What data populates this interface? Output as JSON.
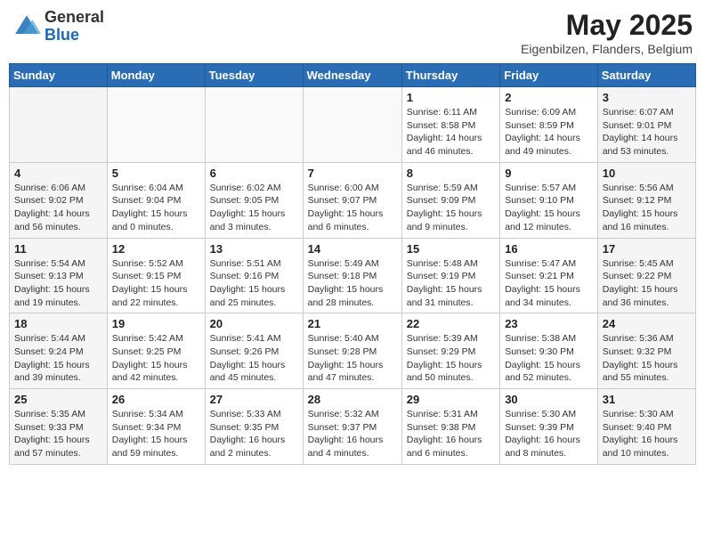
{
  "header": {
    "logo_general": "General",
    "logo_blue": "Blue",
    "month_title": "May 2025",
    "subtitle": "Eigenbilzen, Flanders, Belgium"
  },
  "weekdays": [
    "Sunday",
    "Monday",
    "Tuesday",
    "Wednesday",
    "Thursday",
    "Friday",
    "Saturday"
  ],
  "weeks": [
    [
      {
        "day": "",
        "info": ""
      },
      {
        "day": "",
        "info": ""
      },
      {
        "day": "",
        "info": ""
      },
      {
        "day": "",
        "info": ""
      },
      {
        "day": "1",
        "info": "Sunrise: 6:11 AM\nSunset: 8:58 PM\nDaylight: 14 hours\nand 46 minutes."
      },
      {
        "day": "2",
        "info": "Sunrise: 6:09 AM\nSunset: 8:59 PM\nDaylight: 14 hours\nand 49 minutes."
      },
      {
        "day": "3",
        "info": "Sunrise: 6:07 AM\nSunset: 9:01 PM\nDaylight: 14 hours\nand 53 minutes."
      }
    ],
    [
      {
        "day": "4",
        "info": "Sunrise: 6:06 AM\nSunset: 9:02 PM\nDaylight: 14 hours\nand 56 minutes."
      },
      {
        "day": "5",
        "info": "Sunrise: 6:04 AM\nSunset: 9:04 PM\nDaylight: 15 hours\nand 0 minutes."
      },
      {
        "day": "6",
        "info": "Sunrise: 6:02 AM\nSunset: 9:05 PM\nDaylight: 15 hours\nand 3 minutes."
      },
      {
        "day": "7",
        "info": "Sunrise: 6:00 AM\nSunset: 9:07 PM\nDaylight: 15 hours\nand 6 minutes."
      },
      {
        "day": "8",
        "info": "Sunrise: 5:59 AM\nSunset: 9:09 PM\nDaylight: 15 hours\nand 9 minutes."
      },
      {
        "day": "9",
        "info": "Sunrise: 5:57 AM\nSunset: 9:10 PM\nDaylight: 15 hours\nand 12 minutes."
      },
      {
        "day": "10",
        "info": "Sunrise: 5:56 AM\nSunset: 9:12 PM\nDaylight: 15 hours\nand 16 minutes."
      }
    ],
    [
      {
        "day": "11",
        "info": "Sunrise: 5:54 AM\nSunset: 9:13 PM\nDaylight: 15 hours\nand 19 minutes."
      },
      {
        "day": "12",
        "info": "Sunrise: 5:52 AM\nSunset: 9:15 PM\nDaylight: 15 hours\nand 22 minutes."
      },
      {
        "day": "13",
        "info": "Sunrise: 5:51 AM\nSunset: 9:16 PM\nDaylight: 15 hours\nand 25 minutes."
      },
      {
        "day": "14",
        "info": "Sunrise: 5:49 AM\nSunset: 9:18 PM\nDaylight: 15 hours\nand 28 minutes."
      },
      {
        "day": "15",
        "info": "Sunrise: 5:48 AM\nSunset: 9:19 PM\nDaylight: 15 hours\nand 31 minutes."
      },
      {
        "day": "16",
        "info": "Sunrise: 5:47 AM\nSunset: 9:21 PM\nDaylight: 15 hours\nand 34 minutes."
      },
      {
        "day": "17",
        "info": "Sunrise: 5:45 AM\nSunset: 9:22 PM\nDaylight: 15 hours\nand 36 minutes."
      }
    ],
    [
      {
        "day": "18",
        "info": "Sunrise: 5:44 AM\nSunset: 9:24 PM\nDaylight: 15 hours\nand 39 minutes."
      },
      {
        "day": "19",
        "info": "Sunrise: 5:42 AM\nSunset: 9:25 PM\nDaylight: 15 hours\nand 42 minutes."
      },
      {
        "day": "20",
        "info": "Sunrise: 5:41 AM\nSunset: 9:26 PM\nDaylight: 15 hours\nand 45 minutes."
      },
      {
        "day": "21",
        "info": "Sunrise: 5:40 AM\nSunset: 9:28 PM\nDaylight: 15 hours\nand 47 minutes."
      },
      {
        "day": "22",
        "info": "Sunrise: 5:39 AM\nSunset: 9:29 PM\nDaylight: 15 hours\nand 50 minutes."
      },
      {
        "day": "23",
        "info": "Sunrise: 5:38 AM\nSunset: 9:30 PM\nDaylight: 15 hours\nand 52 minutes."
      },
      {
        "day": "24",
        "info": "Sunrise: 5:36 AM\nSunset: 9:32 PM\nDaylight: 15 hours\nand 55 minutes."
      }
    ],
    [
      {
        "day": "25",
        "info": "Sunrise: 5:35 AM\nSunset: 9:33 PM\nDaylight: 15 hours\nand 57 minutes."
      },
      {
        "day": "26",
        "info": "Sunrise: 5:34 AM\nSunset: 9:34 PM\nDaylight: 15 hours\nand 59 minutes."
      },
      {
        "day": "27",
        "info": "Sunrise: 5:33 AM\nSunset: 9:35 PM\nDaylight: 16 hours\nand 2 minutes."
      },
      {
        "day": "28",
        "info": "Sunrise: 5:32 AM\nSunset: 9:37 PM\nDaylight: 16 hours\nand 4 minutes."
      },
      {
        "day": "29",
        "info": "Sunrise: 5:31 AM\nSunset: 9:38 PM\nDaylight: 16 hours\nand 6 minutes."
      },
      {
        "day": "30",
        "info": "Sunrise: 5:30 AM\nSunset: 9:39 PM\nDaylight: 16 hours\nand 8 minutes."
      },
      {
        "day": "31",
        "info": "Sunrise: 5:30 AM\nSunset: 9:40 PM\nDaylight: 16 hours\nand 10 minutes."
      }
    ]
  ]
}
